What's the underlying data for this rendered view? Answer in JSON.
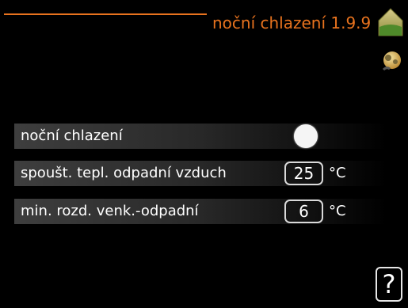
{
  "header": {
    "title": "noční chlazení 1.9.9",
    "accent_color": "#e8731e",
    "home_icon": "house-icon",
    "settings_icon": "settings-gear-icon"
  },
  "settings": {
    "night_cooling": {
      "label": "noční chlazení",
      "state": "on"
    },
    "start_temp_exhaust_air": {
      "label": "spoušt. tepl. odpadní vzduch",
      "value": "25",
      "unit": "°C"
    },
    "min_diff_outdoor_exhaust": {
      "label": "min. rozd. venk.-odpadní",
      "value": "6",
      "unit": "°C"
    }
  },
  "help": {
    "label": "?"
  }
}
